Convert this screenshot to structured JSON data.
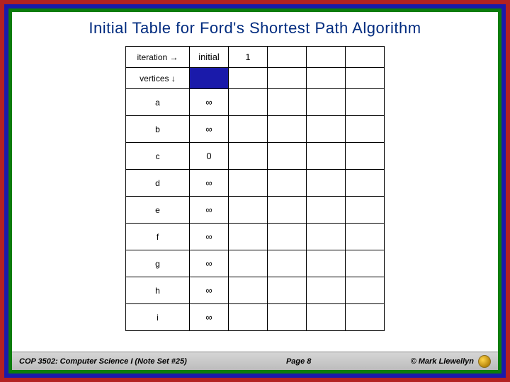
{
  "title": "Initial Table for Ford's Shortest Path Algorithm",
  "table": {
    "iteration_label": "iteration →",
    "vertices_label": "vertices ↓",
    "col_headers": [
      "initial",
      "1",
      "",
      "",
      ""
    ],
    "rows": [
      {
        "vertex": "a",
        "values": [
          "∞",
          "",
          "",
          "",
          ""
        ]
      },
      {
        "vertex": "b",
        "values": [
          "∞",
          "",
          "",
          "",
          ""
        ]
      },
      {
        "vertex": "c",
        "values": [
          "0",
          "",
          "",
          "",
          ""
        ]
      },
      {
        "vertex": "d",
        "values": [
          "∞",
          "",
          "",
          "",
          ""
        ]
      },
      {
        "vertex": "e",
        "values": [
          "∞",
          "",
          "",
          "",
          ""
        ]
      },
      {
        "vertex": "f",
        "values": [
          "∞",
          "",
          "",
          "",
          ""
        ]
      },
      {
        "vertex": "g",
        "values": [
          "∞",
          "",
          "",
          "",
          ""
        ]
      },
      {
        "vertex": "h",
        "values": [
          "∞",
          "",
          "",
          "",
          ""
        ]
      },
      {
        "vertex": "i",
        "values": [
          "∞",
          "",
          "",
          "",
          ""
        ]
      }
    ]
  },
  "footer": {
    "left": "COP 3502: Computer Science I (Note Set #25)",
    "mid": "Page 8",
    "right": "© Mark Llewellyn"
  }
}
